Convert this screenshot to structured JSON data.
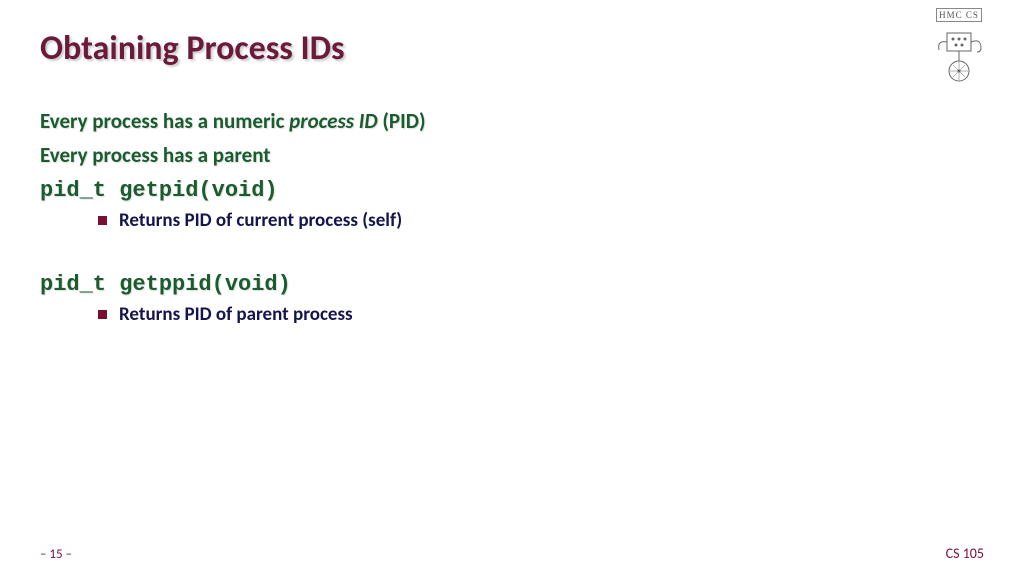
{
  "title": "Obtaining Process IDs",
  "logo": {
    "banner": "HMC CS"
  },
  "content": {
    "line1_pre": "Every process has a numeric ",
    "line1_ital": "process ID",
    "line1_post": " (PID)",
    "line2": "Every process has a parent",
    "code1": "pid_t getpid(void)",
    "bullet1": "Returns PID of current process (self)",
    "code2": "pid_t getppid(void)",
    "bullet2": "Returns PID of parent process"
  },
  "footer": {
    "left": "– 15 –",
    "right": "CS 105"
  }
}
